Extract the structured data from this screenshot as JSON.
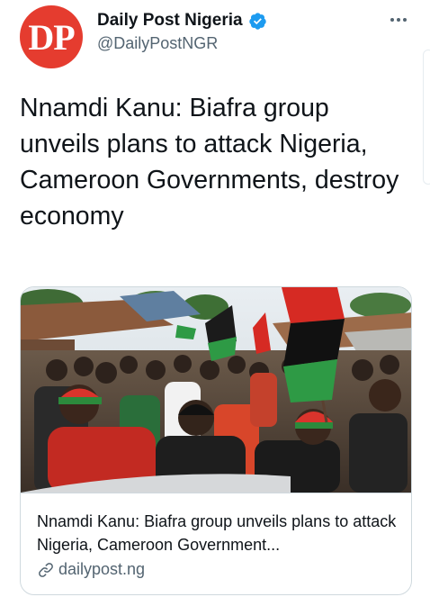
{
  "header": {
    "avatar_text": "DP",
    "display_name": "Daily Post Nigeria",
    "handle": "@DailyPostNGR",
    "verified_icon": "verified-badge-icon",
    "more_icon": "more-horizontal-icon"
  },
  "tweet": {
    "text": "Nnamdi Kanu: Biafra group unveils plans to attack Nigeria, Cameroon Governments, destroy economy"
  },
  "card": {
    "title": "Nnamdi Kanu: Biafra group unveils plans to attack Nigeria, Cameroon Government...",
    "domain": "dailypost.ng",
    "link_icon": "link-icon"
  },
  "colors": {
    "brand": "#e53c2f",
    "verified": "#1d9bf0",
    "text_primary": "#0f1419",
    "text_secondary": "#536471",
    "border": "#cfd9de"
  }
}
